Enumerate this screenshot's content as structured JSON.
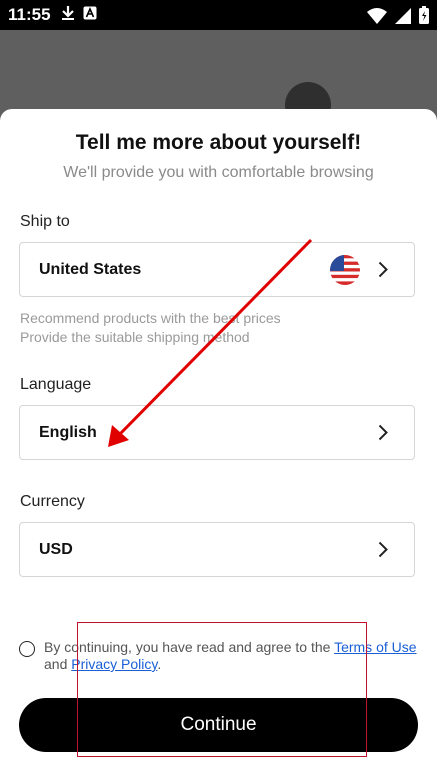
{
  "status_bar": {
    "time": "11:55",
    "left_icons": [
      "download-icon",
      "notification-a-icon"
    ],
    "right_icons": [
      "wifi-icon",
      "signal-icon",
      "battery-icon"
    ]
  },
  "sheet": {
    "title": "Tell me more about yourself!",
    "subtitle": "We'll provide you with comfortable browsing"
  },
  "ship_to": {
    "label": "Ship to",
    "value": "United States",
    "flag_icon": "us-flag-icon",
    "hint_line1": "Recommend products with the best prices",
    "hint_line2": "Provide the suitable shipping method"
  },
  "language": {
    "label": "Language",
    "value": "English"
  },
  "currency": {
    "label": "Currency",
    "value": "USD"
  },
  "agreement": {
    "prefix": "By continuing, you have read and agree to the ",
    "terms_link": "Terms of Use",
    "middle": " and ",
    "privacy_link": "Privacy Policy",
    "suffix": "."
  },
  "continue_button": {
    "label": "Continue"
  },
  "colors": {
    "link": "#1a5fd6",
    "button_bg": "#000000",
    "annotation_red": "#e00000"
  }
}
